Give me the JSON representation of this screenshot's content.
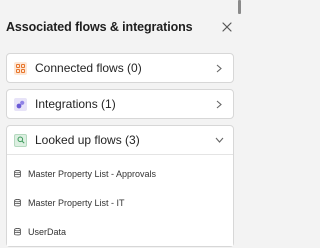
{
  "panel": {
    "title": "Associated flows & integrations",
    "close_icon": "close-icon"
  },
  "sections": [
    {
      "label": "Connected flows (0)",
      "icon": "connected-flows-icon",
      "icon_color": "#e8762d",
      "expanded": false
    },
    {
      "label": "Integrations (1)",
      "icon": "integrations-icon",
      "icon_color": "#6a5ad6",
      "expanded": false
    },
    {
      "label": "Looked up flows (3)",
      "icon": "lookup-search-icon",
      "icon_color": "#3c9a5b",
      "expanded": true
    }
  ],
  "lookup_items": [
    {
      "label": "Master Property List - Approvals",
      "icon": "database-icon"
    },
    {
      "label": "Master Property List - IT",
      "icon": "database-icon"
    },
    {
      "label": "UserData",
      "icon": "database-icon"
    }
  ]
}
